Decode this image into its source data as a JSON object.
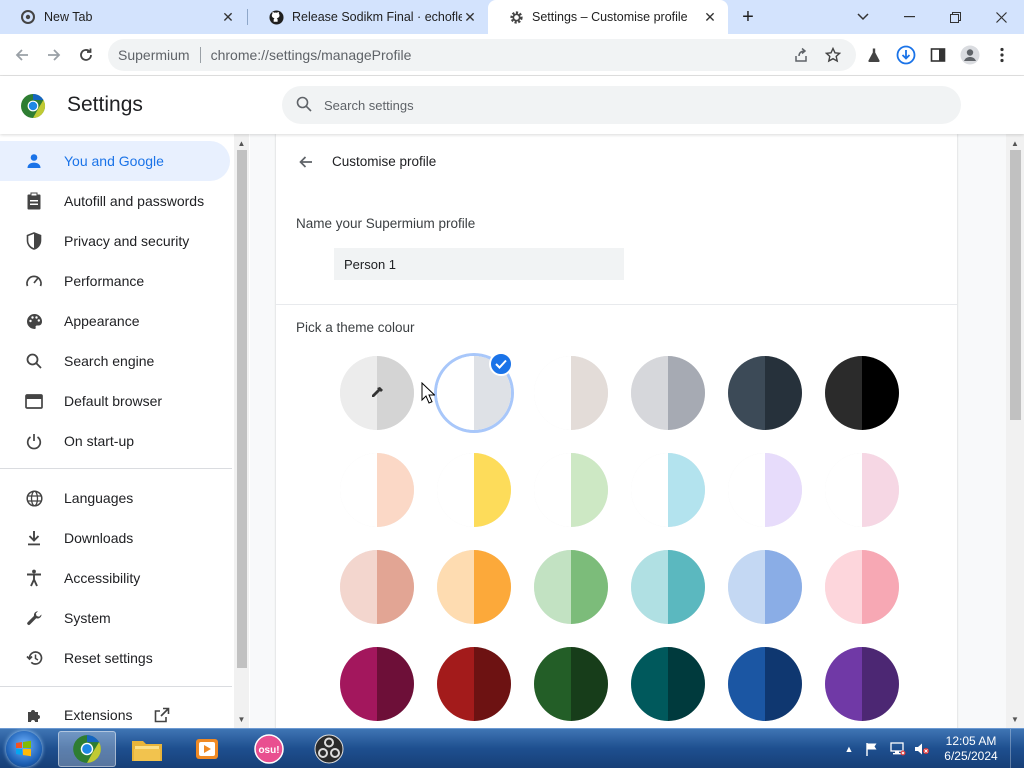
{
  "browser": {
    "tabs": [
      {
        "title": "New Tab",
        "icon": "supermium-icon"
      },
      {
        "title": "Release Sodikm Final · echofles…",
        "icon": "github-icon"
      },
      {
        "title": "Settings – Customise profile",
        "icon": "gear-icon"
      }
    ],
    "omnibox": {
      "host": "Supermium",
      "url": "chrome://settings/manageProfile"
    }
  },
  "settings": {
    "title": "Settings",
    "search_placeholder": "Search settings",
    "nav": [
      {
        "label": "You and Google",
        "icon": "person-icon",
        "active": true
      },
      {
        "label": "Autofill and passwords",
        "icon": "clipboard-icon"
      },
      {
        "label": "Privacy and security",
        "icon": "shield-icon"
      },
      {
        "label": "Performance",
        "icon": "speedometer-icon"
      },
      {
        "label": "Appearance",
        "icon": "palette-icon"
      },
      {
        "label": "Search engine",
        "icon": "search-icon"
      },
      {
        "label": "Default browser",
        "icon": "browser-window-icon"
      },
      {
        "label": "On start-up",
        "icon": "power-icon"
      },
      {
        "label": "Languages",
        "icon": "globe-icon"
      },
      {
        "label": "Downloads",
        "icon": "download-icon"
      },
      {
        "label": "Accessibility",
        "icon": "accessibility-icon"
      },
      {
        "label": "System",
        "icon": "wrench-icon"
      },
      {
        "label": "Reset settings",
        "icon": "history-icon"
      },
      {
        "label": "Extensions",
        "icon": "puzzle-icon"
      }
    ]
  },
  "profile": {
    "page_title": "Customise profile",
    "name_label": "Name your Supermium profile",
    "name_value": "Person 1",
    "theme_label": "Pick a theme colour",
    "selected_index": 1,
    "swatches": [
      {
        "l": "#ececec",
        "r": "#d4d4d4",
        "custom": true
      },
      {
        "l": "#ffffff",
        "r": "#dee1e6"
      },
      {
        "l": "#ffffff",
        "r": "#e3dcd8"
      },
      {
        "l": "#d6d7db",
        "r": "#a6aab3"
      },
      {
        "l": "#3c4a57",
        "r": "#26313b"
      },
      {
        "l": "#2b2b2b",
        "r": "#000000"
      },
      {
        "l": "#ffffff",
        "r": "#fbd8c6"
      },
      {
        "l": "#ffffff",
        "r": "#fddc5a"
      },
      {
        "l": "#ffffff",
        "r": "#cde8c4"
      },
      {
        "l": "#ffffff",
        "r": "#b3e3ee"
      },
      {
        "l": "#ffffff",
        "r": "#e7dcfb"
      },
      {
        "l": "#ffffff",
        "r": "#f6d7e4"
      },
      {
        "l": "#f3d6ce",
        "r": "#e2a594"
      },
      {
        "l": "#fedcb1",
        "r": "#fca93a"
      },
      {
        "l": "#c2e2c2",
        "r": "#7cbc7a"
      },
      {
        "l": "#b0e0e3",
        "r": "#5bb8bf"
      },
      {
        "l": "#c4d8f3",
        "r": "#8aade6"
      },
      {
        "l": "#fdd6dc",
        "r": "#f7a8b4"
      },
      {
        "l": "#a3175d",
        "r": "#6d0f38"
      },
      {
        "l": "#a31b1b",
        "r": "#6d1212"
      },
      {
        "l": "#235e27",
        "r": "#173d1a"
      },
      {
        "l": "#00595c",
        "r": "#003a3d"
      },
      {
        "l": "#1b56a3",
        "r": "#0f3770"
      },
      {
        "l": "#7039a6",
        "r": "#4c2773"
      }
    ]
  },
  "taskbar": {
    "time": "12:05 AM",
    "date": "6/25/2024",
    "apps": [
      "supermium-icon",
      "file-explorer-icon",
      "media-player-icon",
      "osu-icon",
      "obs-icon"
    ]
  }
}
